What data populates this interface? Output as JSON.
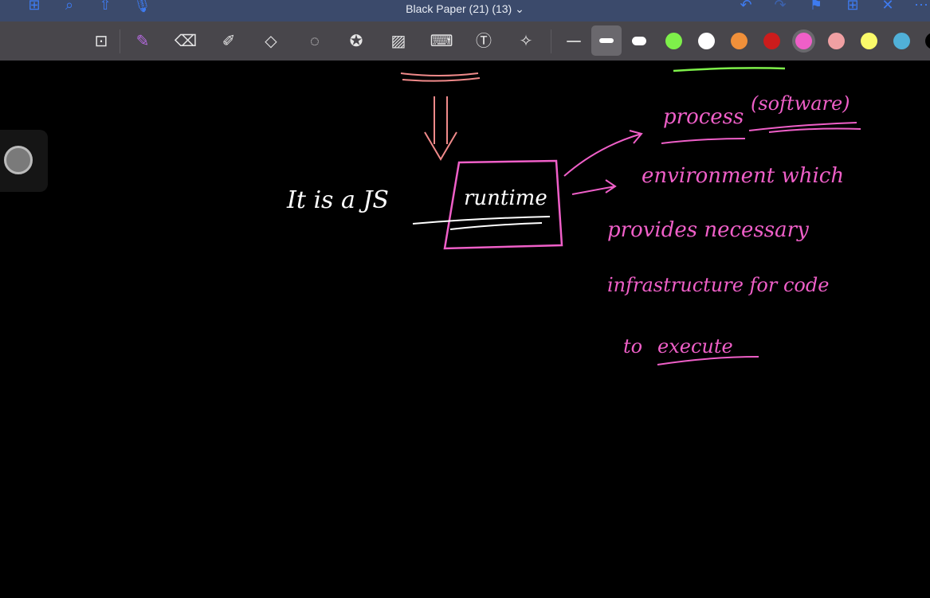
{
  "window": {
    "title": "Black Paper (21) (13) ⌄"
  },
  "topbar_icons": [
    "grid-icon",
    "search-icon",
    "share-icon",
    "microphone-icon",
    "undo-icon",
    "redo-icon",
    "bookmark-icon",
    "add-page-icon",
    "close-icon",
    "more-icon"
  ],
  "toolbar": {
    "tools": [
      "zoom-window-icon",
      "pen-icon",
      "eraser-icon",
      "highlighter-icon",
      "shapes-icon",
      "lasso-icon",
      "sticker-icon",
      "image-icon",
      "keyboard-icon",
      "text-box-icon",
      "laser-pointer-icon"
    ],
    "stroke_widths": [
      "thin",
      "medium",
      "thick"
    ],
    "selected_stroke": "medium",
    "colors": [
      "#7ef04a",
      "#ffffff",
      "#f0903a",
      "#cc1c1c",
      "#ef5fc8",
      "#f0a0a3",
      "#fafa6a",
      "#50b0d8",
      "#000000"
    ],
    "selected_color": "#ef5fc8"
  },
  "notes": {
    "main": "It is a JS",
    "boxed": "runtime",
    "process": "process",
    "software": "(software)",
    "line1": "environment which",
    "line2": "provides necessary",
    "line3": "infrastructure for code",
    "line4a": "to",
    "line4b": "execute"
  }
}
